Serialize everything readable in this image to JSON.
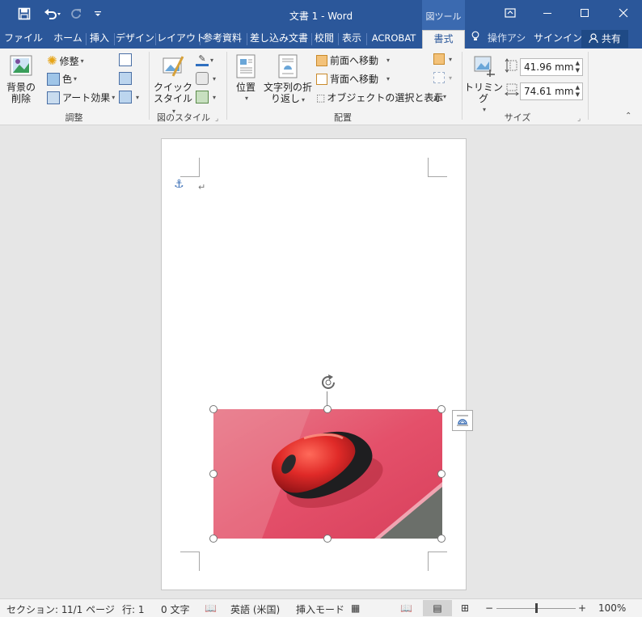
{
  "titlebar": {
    "title": "文書 1 - Word",
    "tool_context": "図ツール",
    "qat": {
      "save_icon": "save-icon",
      "undo_icon": "undo-icon",
      "redo_icon": "redo-icon",
      "customize_icon": "customize-qat-icon"
    }
  },
  "window": {
    "ribbon_display_icon": "ribbon-display-options-icon",
    "minimize_icon": "minimize-icon",
    "maximize_icon": "maximize-icon",
    "close_icon": "close-icon"
  },
  "tabs": [
    {
      "label": "ファイル"
    },
    {
      "label": "ホーム"
    },
    {
      "label": "挿入"
    },
    {
      "label": "デザイン"
    },
    {
      "label": "レイアウト"
    },
    {
      "label": "参考資料"
    },
    {
      "label": "差し込み文書"
    },
    {
      "label": "校閲"
    },
    {
      "label": "表示"
    },
    {
      "label": "ACROBAT"
    },
    {
      "label": "書式"
    }
  ],
  "tellme": "操作アシ",
  "signin": "サインイン",
  "share": "共有",
  "ribbon": {
    "adjust": {
      "label": "調整",
      "remove_bg": "背景の\n削除",
      "remove_bg_l1": "背景の",
      "remove_bg_l2": "削除",
      "corrections": "修整",
      "color": "色",
      "artistic": "アート効果"
    },
    "styles": {
      "label": "図のスタイル",
      "quick_l1": "クイック",
      "quick_l2": "スタイル"
    },
    "arrange": {
      "label": "配置",
      "position": "位置",
      "wrap_l1": "文字列の折",
      "wrap_l2": "り返し",
      "bring_forward": "前面へ移動",
      "send_backward": "背面へ移動",
      "selection_pane": "オブジェクトの選択と表示"
    },
    "size": {
      "label": "サイズ",
      "crop": "トリミング",
      "height": "41.96 mm",
      "width": "74.61 mm"
    }
  },
  "document": {
    "anchor_icon": "anchor-icon",
    "paragraph_mark": "↵",
    "image_desc": "red-computer-mouse-photo"
  },
  "status": {
    "section": "セクション: 1",
    "page": "1/1 ページ",
    "line": "行: 1",
    "chars": "0 文字",
    "language": "英語 (米国)",
    "mode": "挿入モード",
    "zoom": "100%",
    "zoom_level": 100
  },
  "colors": {
    "accent": "#2b579a",
    "image_bg": "#e05068",
    "mouse": "#d8262a"
  }
}
